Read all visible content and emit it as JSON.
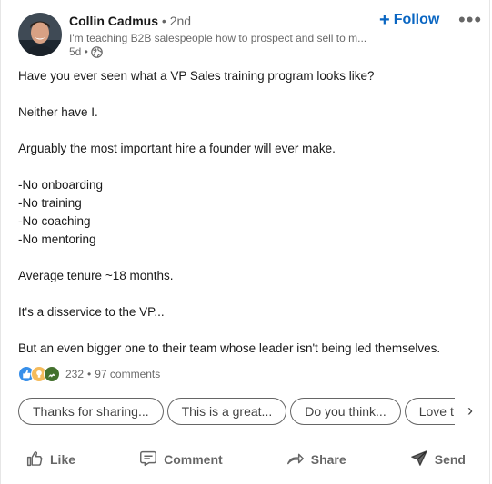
{
  "post": {
    "author": {
      "name": "Collin Cadmus",
      "degree": "• 2nd",
      "headline": "I'm teaching B2B salespeople how to prospect and sell to m...",
      "time": "5d •",
      "visibility_icon": "globe-icon"
    },
    "follow": {
      "plus": "+",
      "label": "Follow"
    },
    "more_label": "•••",
    "text": {
      "line1": "Have you ever seen what a VP Sales training program looks like?",
      "line2": "Neither have I.",
      "line3": "Arguably the most important hire a founder will ever make.",
      "line4": "-No onboarding",
      "line5": "-No training",
      "line6": "-No coaching",
      "line7": "-No mentoring",
      "line8": "Average tenure ~18 months.",
      "line9": "It's a disservice to the VP...",
      "line10": "But an even bigger one to their team whose leader isn't being led themselves."
    },
    "social": {
      "reactions": "232",
      "separator": "•",
      "comments": "97 comments",
      "reaction_icons": [
        "like-icon",
        "insightful-icon",
        "celebrate-icon"
      ]
    },
    "suggestions": [
      "Thanks for sharing...",
      "This is a great...",
      "Do you think...",
      "Love t"
    ],
    "suggestions_next": "›",
    "actions": {
      "like": "Like",
      "comment": "Comment",
      "share": "Share",
      "send": "Send"
    },
    "colors": {
      "accent": "#0a66c2",
      "like": "#378fe9",
      "insightful": "#f5bb5c",
      "celebrate": "#44712e"
    }
  }
}
